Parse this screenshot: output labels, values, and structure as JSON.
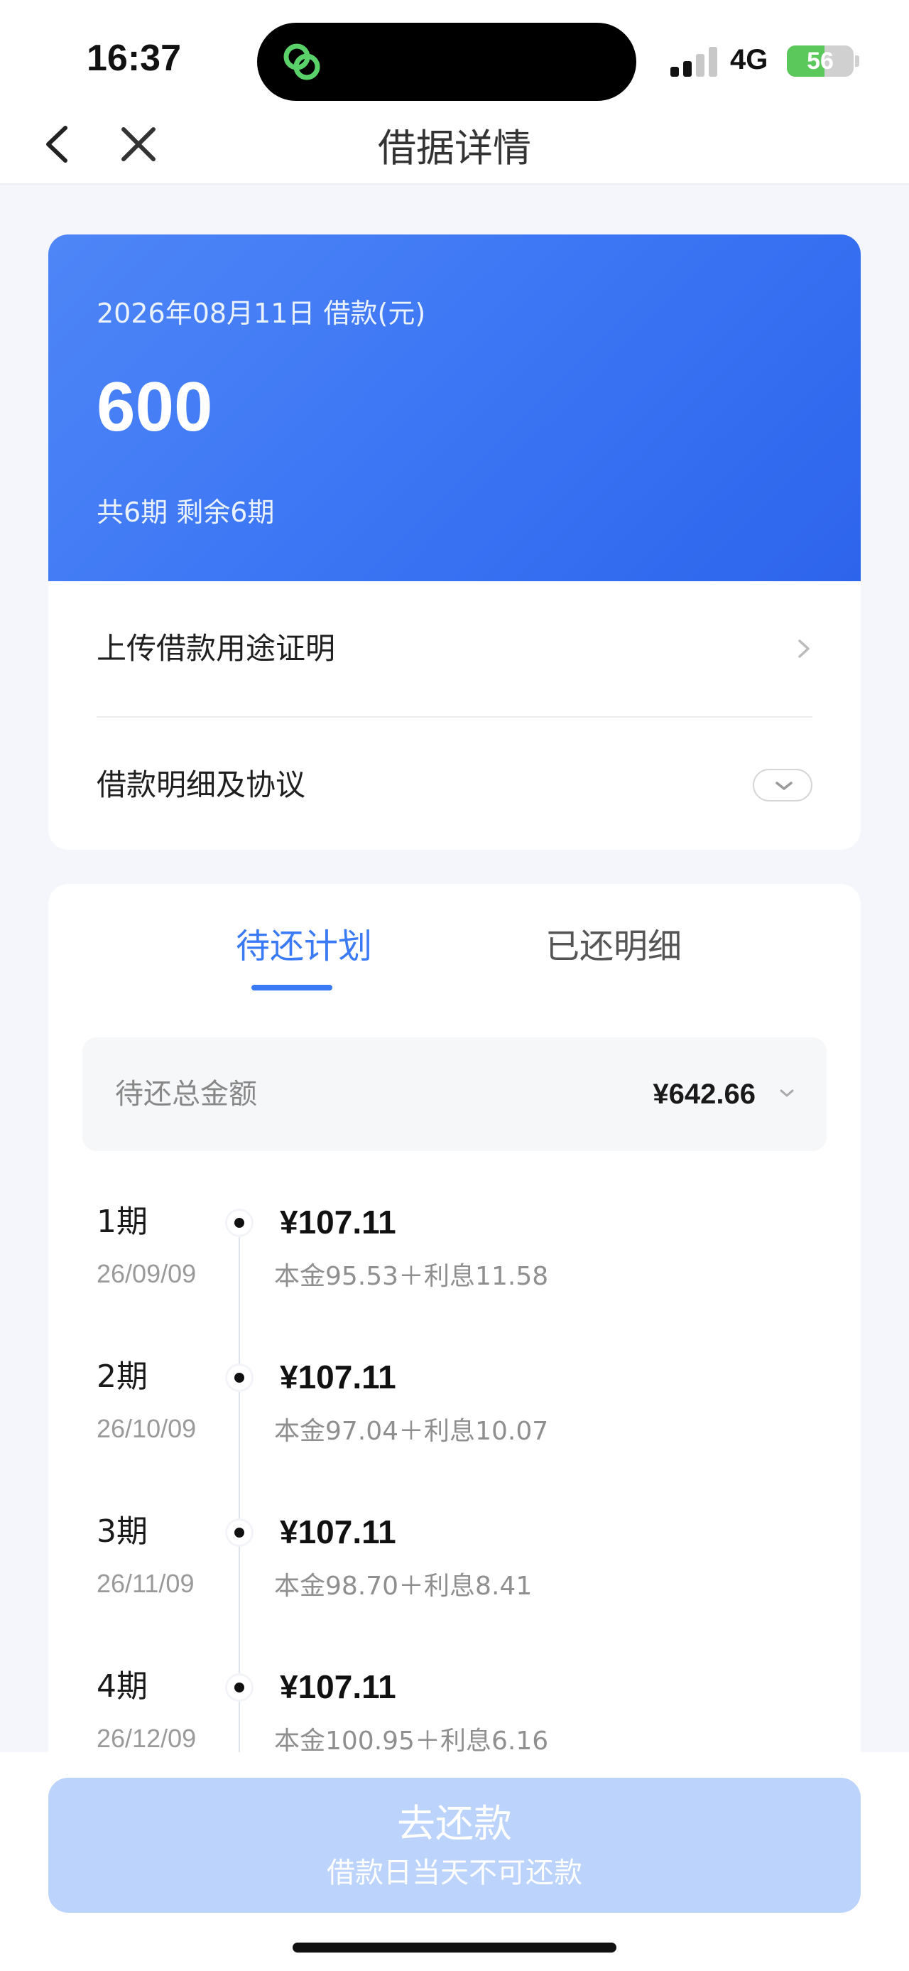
{
  "status_bar": {
    "time": "16:37",
    "network": "4G",
    "battery_percent": 56,
    "battery_label": "56"
  },
  "nav": {
    "title": "借据详情"
  },
  "loan": {
    "date_label": "2026年08月11日 借款(元)",
    "amount": "600",
    "periods_label": "共6期  剩余6期",
    "rows": [
      {
        "label": "上传借款用途证明"
      },
      {
        "label": "借款明细及协议"
      }
    ]
  },
  "plan": {
    "tabs": [
      {
        "label": "待还计划",
        "active": true
      },
      {
        "label": "已还明细",
        "active": false
      }
    ],
    "total_label": "待还总金额",
    "total_value": "¥642.66",
    "installments": [
      {
        "period": "1期",
        "date": "26/09/09",
        "amount": "¥107.11",
        "detail": "本金95.53＋利息11.58"
      },
      {
        "period": "2期",
        "date": "26/10/09",
        "amount": "¥107.11",
        "detail": "本金97.04＋利息10.07"
      },
      {
        "period": "3期",
        "date": "26/11/09",
        "amount": "¥107.11",
        "detail": "本金98.70＋利息8.41"
      },
      {
        "period": "4期",
        "date": "26/12/09",
        "amount": "¥107.11",
        "detail": "本金100.95＋利息6.16"
      }
    ]
  },
  "bottom": {
    "button_label": "去还款",
    "button_sub": "借款日当天不可还款"
  },
  "colors": {
    "accent": "#3a7af5",
    "card_gradient_start": "#4e86f7",
    "card_gradient_end": "#2d64ec",
    "button_disabled": "#bcd3fb",
    "battery_green": "#5ac85a"
  }
}
